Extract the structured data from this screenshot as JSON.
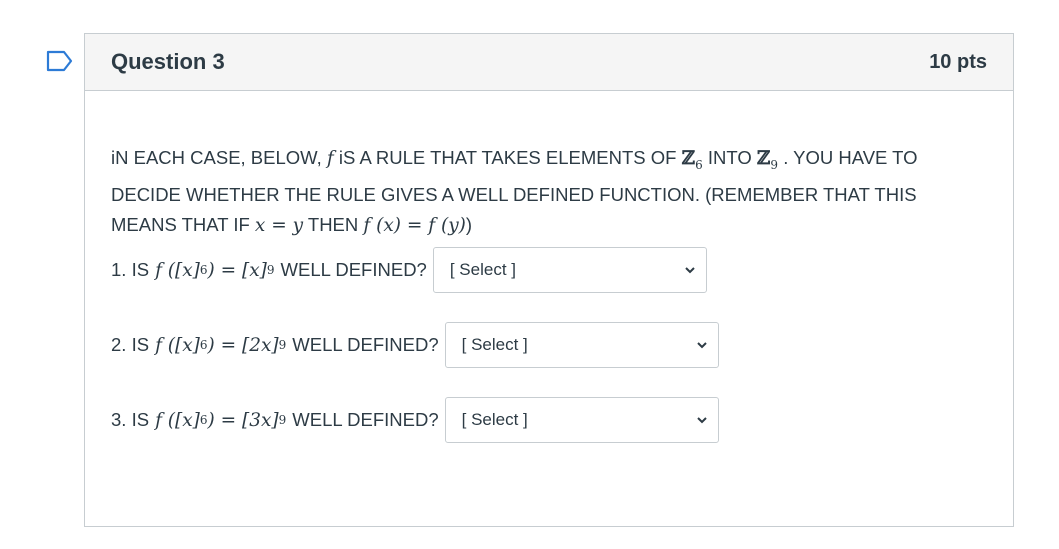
{
  "question": {
    "title": "Question 3",
    "points": "10 pts",
    "prompt_parts": {
      "p1": "iN EACH CASE, BELOW,",
      "f": "f",
      "p2": "iS A RULE THAT TAKES ELEMENTS OF",
      "z": "ℤ",
      "sub6": "6",
      "p3": "INTO",
      "sub9": "9",
      "p4": ". YOU HAVE TO DECIDE WHETHER THE RULE GIVES A WELL DEFINED FUNCTION. (REMEMBER THAT THIS MEANS THAT IF",
      "eq1": "x = y",
      "p5": "THEN",
      "eq2": "f (x) = f (y)",
      "p6": ")"
    },
    "items": [
      {
        "prefix": "1. IS",
        "lhs": "f ([x]",
        "lhs_sub": "6",
        "mid": ") = [x]",
        "rhs_sub": "9",
        "suffix": "WELL DEFINED?",
        "select": "[ Select ]"
      },
      {
        "prefix": "2. IS",
        "lhs": "f ([x]",
        "lhs_sub": "6",
        "mid": ") = [2x]",
        "rhs_sub": "9",
        "suffix": "WELL DEFINED?",
        "select": "[ Select ]"
      },
      {
        "prefix": "3. IS",
        "lhs": "f ([x]",
        "lhs_sub": "6",
        "mid": ") = [3x]",
        "rhs_sub": "9",
        "suffix": "WELL DEFINED?",
        "select": "[ Select ]"
      }
    ]
  },
  "icons": {
    "flag": "flag-icon",
    "chevron": "chevron-down-icon"
  },
  "colors": {
    "text": "#2d3b45",
    "border": "#c7cdd1",
    "header_bg": "#f5f5f5",
    "flag": "#2d7bd6"
  }
}
